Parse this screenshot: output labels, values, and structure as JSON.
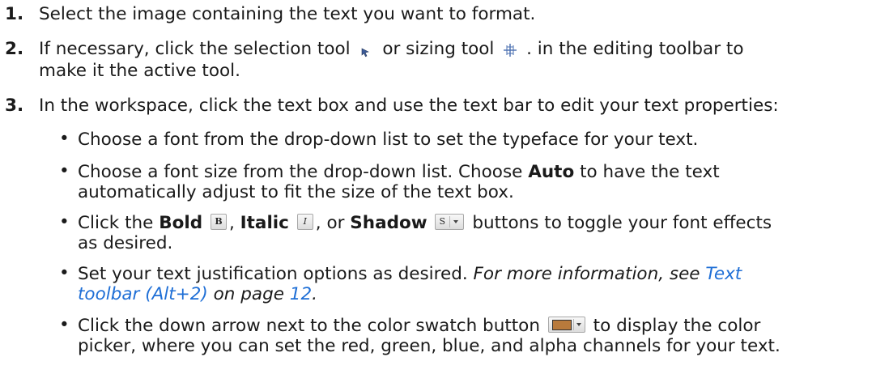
{
  "steps": [
    {
      "num": "1.",
      "text": "Select the image containing the text you want to format."
    },
    {
      "num": "2.",
      "a": "If necessary, click the selection tool",
      "b": "or sizing tool",
      "c": ". in the editing toolbar to",
      "line2": "make it the active tool."
    },
    {
      "num": "3.",
      "text": "In the workspace, click the text box and use the text bar to edit your text properties:"
    }
  ],
  "bullets": [
    {
      "text": "Choose a font from the drop-down list to set the typeface for your text."
    },
    {
      "a": "Choose a font size from the drop-down list. Choose",
      "bold": "Auto",
      "b": "to have the text",
      "line2": "automatically adjust to fit the size of the text box."
    },
    {
      "a": "Click the",
      "bold1": "Bold",
      "c1": ",",
      "bold2": "Italic",
      "c2": ", or",
      "bold3": "Shadow",
      "b": "buttons to toggle your font effects",
      "line2": "as desired.",
      "btn_bold": "B",
      "btn_italic": "I",
      "btn_shadow": "S"
    },
    {
      "a": "Set your text justification options as desired.",
      "em1": "For more information, see",
      "link1": "Text",
      "link2": "toolbar (Alt+2)",
      "em2": "on page",
      "link3": "12",
      "em3": "."
    },
    {
      "a": "Click the down arrow next to the color swatch button",
      "b": "to display the color",
      "line2": "picker, where you can set the red, green, blue, and alpha channels for your text."
    }
  ],
  "bullet_char": "•",
  "colors": {
    "link": "#1f6fd6",
    "swatch": "#b87a3c",
    "selection_icon": "#3b5b9a",
    "sizing_icon": "#4a6fb0"
  }
}
